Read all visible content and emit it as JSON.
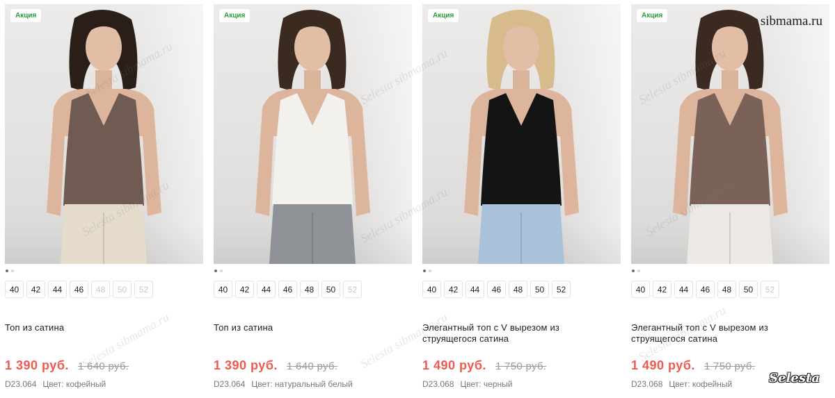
{
  "watermarks": {
    "site": "sibmama.ru",
    "brand": "Selesta",
    "diagonal": "Selesta sibmama.ru"
  },
  "products": [
    {
      "badge": "Акция",
      "image": "model wearing mocha satin camisole with sunglasses and beige jeans",
      "top_color": "#6f5b51",
      "bottom_color": "#e6dccb",
      "hair_color": "#2a1e18",
      "sizes": [
        {
          "label": "40",
          "available": true
        },
        {
          "label": "42",
          "available": true
        },
        {
          "label": "44",
          "available": true
        },
        {
          "label": "46",
          "available": true
        },
        {
          "label": "48",
          "available": false
        },
        {
          "label": "50",
          "available": false
        },
        {
          "label": "52",
          "available": false
        }
      ],
      "title": "Топ из сатина",
      "price": "1 390 руб.",
      "old_price": "1 640 руб.",
      "sku": "D23.064",
      "color": "Цвет: кофейный"
    },
    {
      "badge": "Акция",
      "image": "model wearing white satin camisole and grey jeans",
      "top_color": "#f3f1ec",
      "bottom_color": "#8f9296",
      "hair_color": "#3a2a20",
      "sizes": [
        {
          "label": "40",
          "available": true
        },
        {
          "label": "42",
          "available": true
        },
        {
          "label": "44",
          "available": true
        },
        {
          "label": "46",
          "available": true
        },
        {
          "label": "48",
          "available": true
        },
        {
          "label": "50",
          "available": true
        },
        {
          "label": "52",
          "available": false
        }
      ],
      "title": "Топ из сатина",
      "price": "1 390 руб.",
      "old_price": "1 640 руб.",
      "sku": "D23.064",
      "color": "Цвет: натуральный белый"
    },
    {
      "badge": "Акция",
      "image": "blonde model wearing black satin v-neck top and light jeans",
      "top_color": "#141414",
      "bottom_color": "#a9c2da",
      "hair_color": "#d8bb8c",
      "sizes": [
        {
          "label": "40",
          "available": true
        },
        {
          "label": "42",
          "available": true
        },
        {
          "label": "44",
          "available": true
        },
        {
          "label": "46",
          "available": true
        },
        {
          "label": "48",
          "available": true
        },
        {
          "label": "50",
          "available": true
        },
        {
          "label": "52",
          "available": true
        }
      ],
      "title": "Элегантный топ с V вырезом из струящегося сатина",
      "price": "1 490 руб.",
      "old_price": "1 750 руб.",
      "sku": "D23.068",
      "color": "Цвет: черный"
    },
    {
      "badge": "Акция",
      "image": "model wearing mocha satin v-neck top with sunglasses",
      "top_color": "#7a6258",
      "bottom_color": "#ece9e4",
      "hair_color": "#3b2a22",
      "sizes": [
        {
          "label": "40",
          "available": true
        },
        {
          "label": "42",
          "available": true
        },
        {
          "label": "44",
          "available": true
        },
        {
          "label": "46",
          "available": true
        },
        {
          "label": "48",
          "available": true
        },
        {
          "label": "50",
          "available": true
        },
        {
          "label": "52",
          "available": false
        }
      ],
      "title": "Элегантный топ с V вырезом из струящегося сатина",
      "price": "1 490 руб.",
      "old_price": "1 750 руб.",
      "sku": "D23.068",
      "color": "Цвет: кофейный"
    }
  ]
}
